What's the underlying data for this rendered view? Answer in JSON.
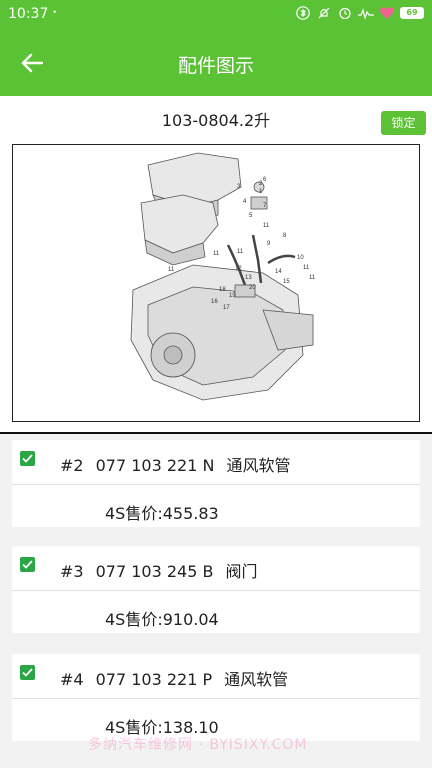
{
  "status": {
    "time": "10:37",
    "notification_dot": "•",
    "battery": "69"
  },
  "app_bar": {
    "title": "配件图示"
  },
  "sub_header": {
    "title": "103-0804.2升",
    "lock_label": "锁定"
  },
  "diagram": {
    "callouts": [
      "3",
      "4",
      "5",
      "6",
      "7",
      "11",
      "11",
      "11",
      "11",
      "8",
      "9",
      "10",
      "11",
      "11",
      "12",
      "13",
      "14",
      "15",
      "16",
      "17",
      "18",
      "19",
      "20",
      "1",
      "2"
    ]
  },
  "parts": [
    {
      "index": "#2",
      "number": "077 103 221 N",
      "name": "通风软管",
      "price": "4S售价:455.83",
      "checked": true
    },
    {
      "index": "#3",
      "number": "077 103 245 B",
      "name": "阀门",
      "price": "4S售价:910.04",
      "checked": true
    },
    {
      "index": "#4",
      "number": "077 103 221 P",
      "name": "通风软管",
      "price": "4S售价:138.10",
      "checked": true
    }
  ],
  "watermark": "多纳汽车维修网 · BYISIXY.COM",
  "colors": {
    "primary": "#5bc236",
    "checkbox": "#2aa744"
  }
}
